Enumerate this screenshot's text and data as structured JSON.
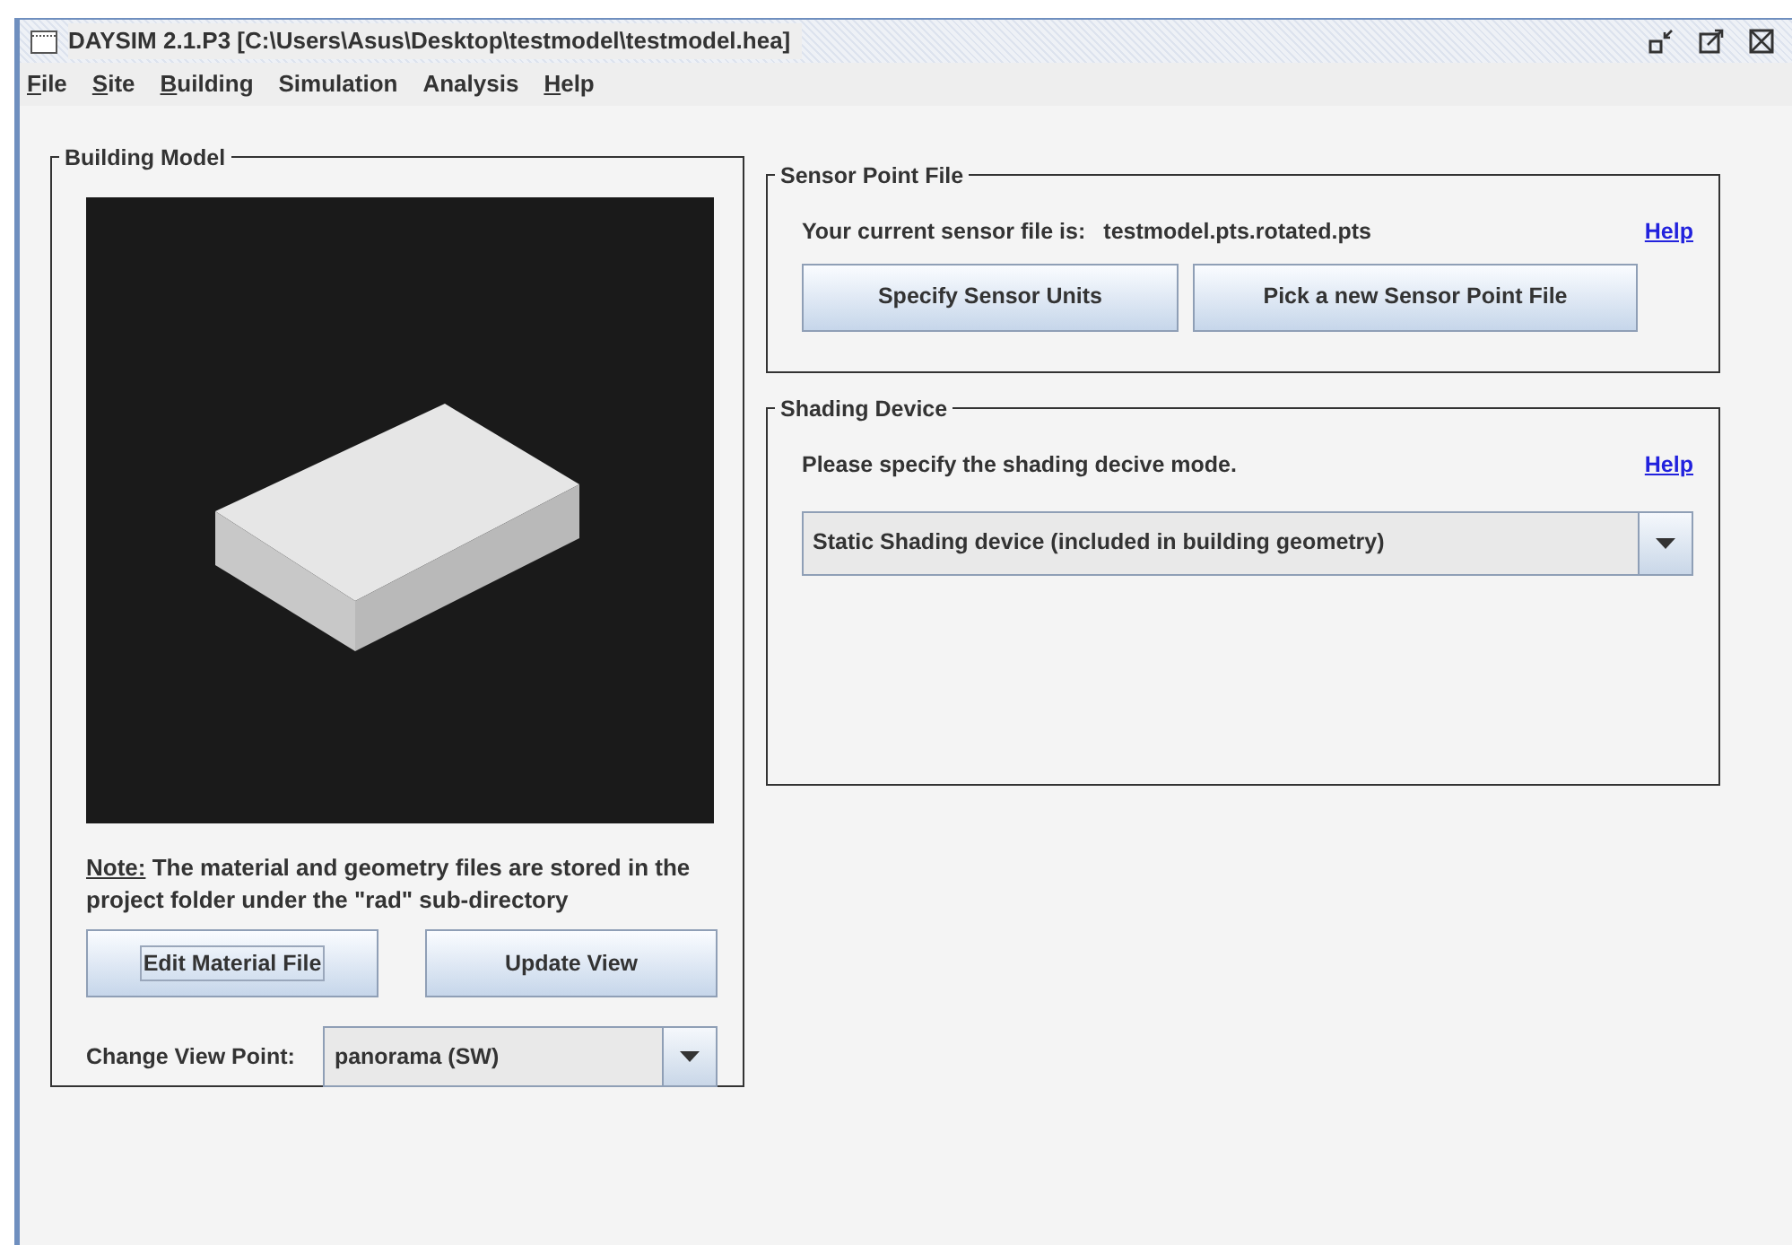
{
  "window": {
    "title": "DAYSIM 2.1.P3 [C:\\Users\\Asus\\Desktop\\testmodel\\testmodel.hea]"
  },
  "menu": [
    {
      "label": "File",
      "mnemonic": true
    },
    {
      "label": "Site",
      "mnemonic": true
    },
    {
      "label": "Building",
      "mnemonic": true
    },
    {
      "label": "Simulation",
      "mnemonic": false
    },
    {
      "label": "Analysis",
      "mnemonic": false
    },
    {
      "label": "Help",
      "mnemonic": true
    }
  ],
  "building_model": {
    "title": "Building Model",
    "note": {
      "label": "Note:",
      "text": " The material and geometry files are stored in the project folder under the \"rad\" sub-directory"
    },
    "buttons": [
      {
        "label": "Edit Material File",
        "focused": true
      },
      {
        "label": "Update View",
        "focused": false
      }
    ],
    "view_point": {
      "label": "Change View Point:",
      "value": "panorama (SW)"
    }
  },
  "sensor_point_file": {
    "title": "Sensor Point File",
    "label": "Your current sensor file is:",
    "value": "testmodel.pts.rotated.pts",
    "help": "Help",
    "buttons": [
      {
        "label": "Specify Sensor Units",
        "focused": false
      },
      {
        "label": "Pick a new Sensor Point File",
        "focused": false
      }
    ]
  },
  "shading_device": {
    "title": "Shading Device",
    "prompt": "Please specify the shading decive mode.",
    "help": "Help",
    "mode": "Static Shading device (included in building geometry)"
  }
}
